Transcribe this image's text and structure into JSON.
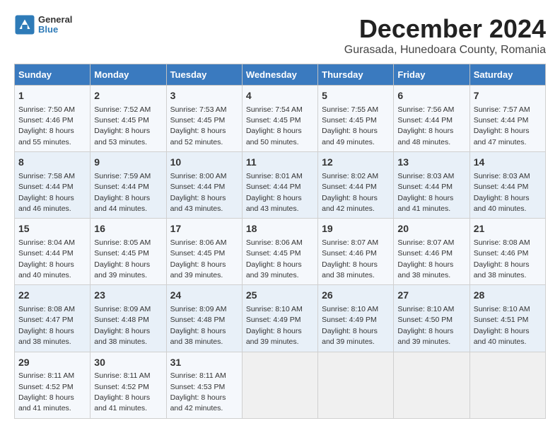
{
  "logo": {
    "general": "General",
    "blue": "Blue"
  },
  "title": "December 2024",
  "subtitle": "Gurasada, Hunedoara County, Romania",
  "days_of_week": [
    "Sunday",
    "Monday",
    "Tuesday",
    "Wednesday",
    "Thursday",
    "Friday",
    "Saturday"
  ],
  "weeks": [
    [
      {
        "day": "1",
        "sunrise": "7:50 AM",
        "sunset": "4:46 PM",
        "daylight": "8 hours and 55 minutes."
      },
      {
        "day": "2",
        "sunrise": "7:52 AM",
        "sunset": "4:45 PM",
        "daylight": "8 hours and 53 minutes."
      },
      {
        "day": "3",
        "sunrise": "7:53 AM",
        "sunset": "4:45 PM",
        "daylight": "8 hours and 52 minutes."
      },
      {
        "day": "4",
        "sunrise": "7:54 AM",
        "sunset": "4:45 PM",
        "daylight": "8 hours and 50 minutes."
      },
      {
        "day": "5",
        "sunrise": "7:55 AM",
        "sunset": "4:45 PM",
        "daylight": "8 hours and 49 minutes."
      },
      {
        "day": "6",
        "sunrise": "7:56 AM",
        "sunset": "4:44 PM",
        "daylight": "8 hours and 48 minutes."
      },
      {
        "day": "7",
        "sunrise": "7:57 AM",
        "sunset": "4:44 PM",
        "daylight": "8 hours and 47 minutes."
      }
    ],
    [
      {
        "day": "8",
        "sunrise": "7:58 AM",
        "sunset": "4:44 PM",
        "daylight": "8 hours and 46 minutes."
      },
      {
        "day": "9",
        "sunrise": "7:59 AM",
        "sunset": "4:44 PM",
        "daylight": "8 hours and 44 minutes."
      },
      {
        "day": "10",
        "sunrise": "8:00 AM",
        "sunset": "4:44 PM",
        "daylight": "8 hours and 43 minutes."
      },
      {
        "day": "11",
        "sunrise": "8:01 AM",
        "sunset": "4:44 PM",
        "daylight": "8 hours and 43 minutes."
      },
      {
        "day": "12",
        "sunrise": "8:02 AM",
        "sunset": "4:44 PM",
        "daylight": "8 hours and 42 minutes."
      },
      {
        "day": "13",
        "sunrise": "8:03 AM",
        "sunset": "4:44 PM",
        "daylight": "8 hours and 41 minutes."
      },
      {
        "day": "14",
        "sunrise": "8:03 AM",
        "sunset": "4:44 PM",
        "daylight": "8 hours and 40 minutes."
      }
    ],
    [
      {
        "day": "15",
        "sunrise": "8:04 AM",
        "sunset": "4:44 PM",
        "daylight": "8 hours and 40 minutes."
      },
      {
        "day": "16",
        "sunrise": "8:05 AM",
        "sunset": "4:45 PM",
        "daylight": "8 hours and 39 minutes."
      },
      {
        "day": "17",
        "sunrise": "8:06 AM",
        "sunset": "4:45 PM",
        "daylight": "8 hours and 39 minutes."
      },
      {
        "day": "18",
        "sunrise": "8:06 AM",
        "sunset": "4:45 PM",
        "daylight": "8 hours and 39 minutes."
      },
      {
        "day": "19",
        "sunrise": "8:07 AM",
        "sunset": "4:46 PM",
        "daylight": "8 hours and 38 minutes."
      },
      {
        "day": "20",
        "sunrise": "8:07 AM",
        "sunset": "4:46 PM",
        "daylight": "8 hours and 38 minutes."
      },
      {
        "day": "21",
        "sunrise": "8:08 AM",
        "sunset": "4:46 PM",
        "daylight": "8 hours and 38 minutes."
      }
    ],
    [
      {
        "day": "22",
        "sunrise": "8:08 AM",
        "sunset": "4:47 PM",
        "daylight": "8 hours and 38 minutes."
      },
      {
        "day": "23",
        "sunrise": "8:09 AM",
        "sunset": "4:48 PM",
        "daylight": "8 hours and 38 minutes."
      },
      {
        "day": "24",
        "sunrise": "8:09 AM",
        "sunset": "4:48 PM",
        "daylight": "8 hours and 38 minutes."
      },
      {
        "day": "25",
        "sunrise": "8:10 AM",
        "sunset": "4:49 PM",
        "daylight": "8 hours and 39 minutes."
      },
      {
        "day": "26",
        "sunrise": "8:10 AM",
        "sunset": "4:49 PM",
        "daylight": "8 hours and 39 minutes."
      },
      {
        "day": "27",
        "sunrise": "8:10 AM",
        "sunset": "4:50 PM",
        "daylight": "8 hours and 39 minutes."
      },
      {
        "day": "28",
        "sunrise": "8:10 AM",
        "sunset": "4:51 PM",
        "daylight": "8 hours and 40 minutes."
      }
    ],
    [
      {
        "day": "29",
        "sunrise": "8:11 AM",
        "sunset": "4:52 PM",
        "daylight": "8 hours and 41 minutes."
      },
      {
        "day": "30",
        "sunrise": "8:11 AM",
        "sunset": "4:52 PM",
        "daylight": "8 hours and 41 minutes."
      },
      {
        "day": "31",
        "sunrise": "8:11 AM",
        "sunset": "4:53 PM",
        "daylight": "8 hours and 42 minutes."
      },
      null,
      null,
      null,
      null
    ]
  ]
}
